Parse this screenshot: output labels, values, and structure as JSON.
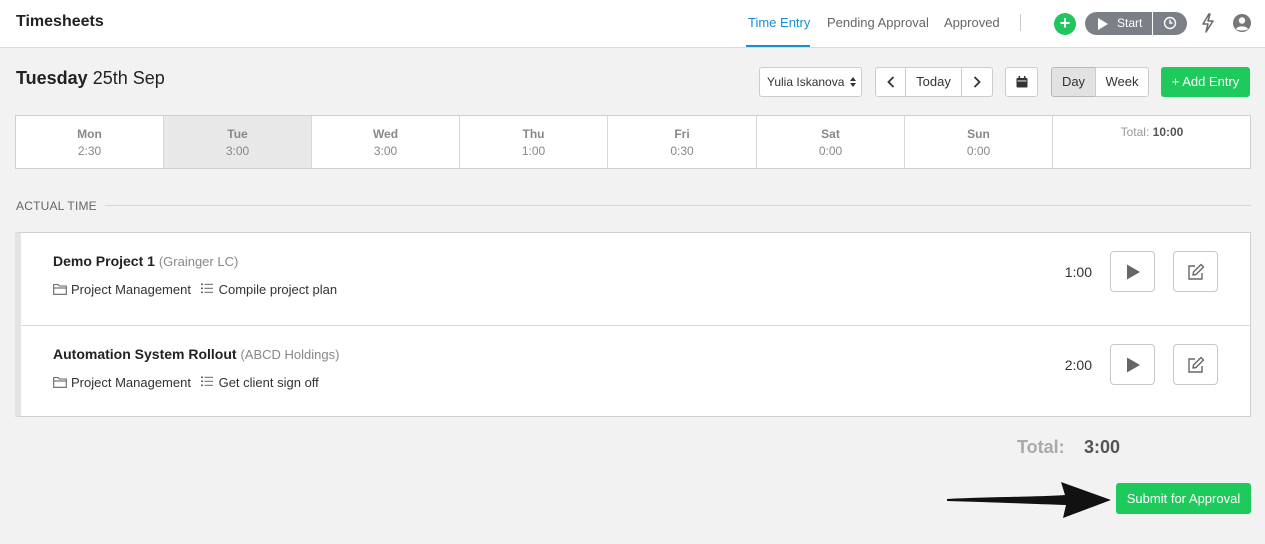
{
  "app": {
    "title": "Timesheets"
  },
  "nav": {
    "tabs": [
      {
        "label": "Time Entry",
        "active": true
      },
      {
        "label": "Pending Approval",
        "active": false
      },
      {
        "label": "Approved",
        "active": false
      }
    ],
    "start_label": "Start"
  },
  "header": {
    "weekday": "Tuesday",
    "date": "25th Sep",
    "user_select": "Yulia Iskanova",
    "today_label": "Today",
    "day_label": "Day",
    "week_label": "Week",
    "add_entry_label": "+ Add Entry"
  },
  "week": {
    "days": [
      {
        "name": "Mon",
        "hours": "2:30",
        "selected": false
      },
      {
        "name": "Tue",
        "hours": "3:00",
        "selected": true
      },
      {
        "name": "Wed",
        "hours": "3:00",
        "selected": false
      },
      {
        "name": "Thu",
        "hours": "1:00",
        "selected": false
      },
      {
        "name": "Fri",
        "hours": "0:30",
        "selected": false
      },
      {
        "name": "Sat",
        "hours": "0:00",
        "selected": false
      },
      {
        "name": "Sun",
        "hours": "0:00",
        "selected": false
      }
    ],
    "total_label": "Total:",
    "total_value": "10:00"
  },
  "section": {
    "label": "ACTUAL TIME"
  },
  "entries": [
    {
      "project": "Demo Project 1",
      "client": "(Grainger LC)",
      "category": "Project Management",
      "task": "Compile project plan",
      "hours": "1:00"
    },
    {
      "project": "Automation System Rollout",
      "client": "(ABCD Holdings)",
      "category": "Project Management",
      "task": "Get client sign off",
      "hours": "2:00"
    }
  ],
  "summary": {
    "total_label": "Total:",
    "total_value": "3:00",
    "submit_label": "Submit for Approval"
  },
  "colors": {
    "accent_blue": "#1a8ccf",
    "green": "#1fca5c",
    "gray_button": "#7b7f86"
  }
}
